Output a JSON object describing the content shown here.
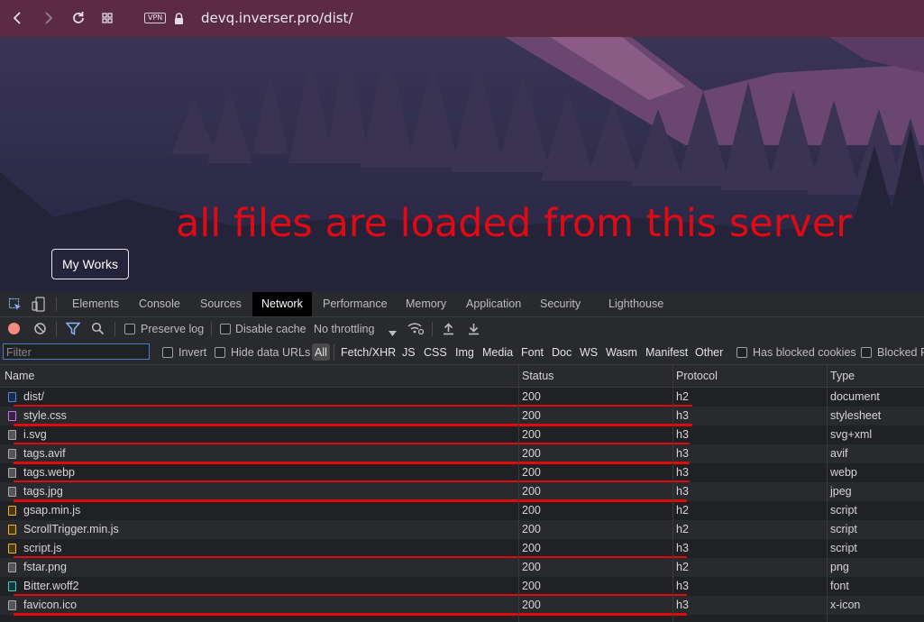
{
  "browser": {
    "url": "devq.inverser.pro/dist/",
    "vpn_label": "VPN",
    "icons": [
      "back-icon",
      "forward-icon",
      "reload-icon",
      "tabs-grid-icon",
      "lock-icon"
    ]
  },
  "page": {
    "annotation": "all files are loaded from this server",
    "my_works_label": "My Works",
    "colors": {
      "annotation": "#e00a14",
      "sky": "#2a2a44",
      "mountain": "#7a4f7a"
    }
  },
  "devtools": {
    "tabs": [
      "Elements",
      "Console",
      "Sources",
      "Network",
      "Performance",
      "Memory",
      "Application",
      "Security",
      "Lighthouse"
    ],
    "active_tab": "Network",
    "toolbar": {
      "preserve_log": "Preserve log",
      "disable_cache": "Disable cache",
      "throttling": "No throttling"
    },
    "filter": {
      "placeholder": "Filter",
      "invert": "Invert",
      "hide_data_urls": "Hide data URLs",
      "types": [
        "All",
        "Fetch/XHR",
        "JS",
        "CSS",
        "Img",
        "Media",
        "Font",
        "Doc",
        "WS",
        "Wasm",
        "Manifest",
        "Other"
      ],
      "active_type": "All",
      "has_blocked_cookies": "Has blocked cookies",
      "blocked_requests": "Blocked R"
    },
    "columns": [
      "Name",
      "Status",
      "Protocol",
      "Type"
    ],
    "rows": [
      {
        "name": "dist/",
        "status": "200",
        "protocol": "h2",
        "type": "document",
        "icon": "document-icon"
      },
      {
        "name": "style.css",
        "status": "200",
        "protocol": "h3",
        "type": "stylesheet",
        "icon": "stylesheet-icon"
      },
      {
        "name": "i.svg",
        "status": "200",
        "protocol": "h3",
        "type": "svg+xml",
        "icon": "image-icon"
      },
      {
        "name": "tags.avif",
        "status": "200",
        "protocol": "h3",
        "type": "avif",
        "icon": "image-icon"
      },
      {
        "name": "tags.webp",
        "status": "200",
        "protocol": "h3",
        "type": "webp",
        "icon": "image-icon"
      },
      {
        "name": "tags.jpg",
        "status": "200",
        "protocol": "h3",
        "type": "jpeg",
        "icon": "image-icon"
      },
      {
        "name": "gsap.min.js",
        "status": "200",
        "protocol": "h2",
        "type": "script",
        "icon": "script-icon"
      },
      {
        "name": "ScrollTrigger.min.js",
        "status": "200",
        "protocol": "h2",
        "type": "script",
        "icon": "script-icon"
      },
      {
        "name": "script.js",
        "status": "200",
        "protocol": "h3",
        "type": "script",
        "icon": "script-icon"
      },
      {
        "name": "fstar.png",
        "status": "200",
        "protocol": "h2",
        "type": "png",
        "icon": "image-icon"
      },
      {
        "name": "Bitter.woff2",
        "status": "200",
        "protocol": "h3",
        "type": "font",
        "icon": "font-icon"
      },
      {
        "name": "favicon.ico",
        "status": "200",
        "protocol": "h3",
        "type": "x-icon",
        "icon": "image-icon"
      }
    ]
  }
}
